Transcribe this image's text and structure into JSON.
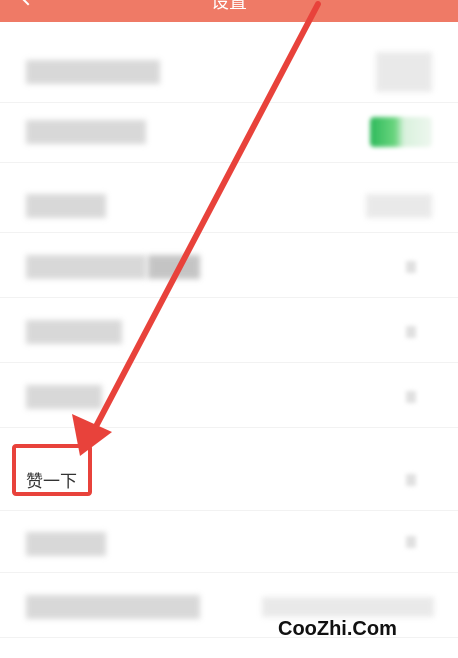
{
  "header": {
    "title": "设置"
  },
  "rows": [
    {
      "label": "",
      "control": "value"
    },
    {
      "label": "",
      "control": "toggle"
    },
    {
      "label": "",
      "control": "value"
    },
    {
      "label": "",
      "control": "chevron"
    },
    {
      "label": "",
      "control": "chevron"
    },
    {
      "label": "",
      "control": "chevron"
    },
    {
      "label": "赞一下",
      "control": "chevron"
    },
    {
      "label": "",
      "control": "chevron"
    },
    {
      "label": "",
      "control": "value"
    }
  ],
  "annotation": {
    "arrow_color": "#e8423b",
    "target": "赞一下"
  },
  "watermark": "CooZhi.Com",
  "colors": {
    "header": "#ef7a66",
    "toggle_on": "#2db95a",
    "annotation": "#e8423b"
  }
}
